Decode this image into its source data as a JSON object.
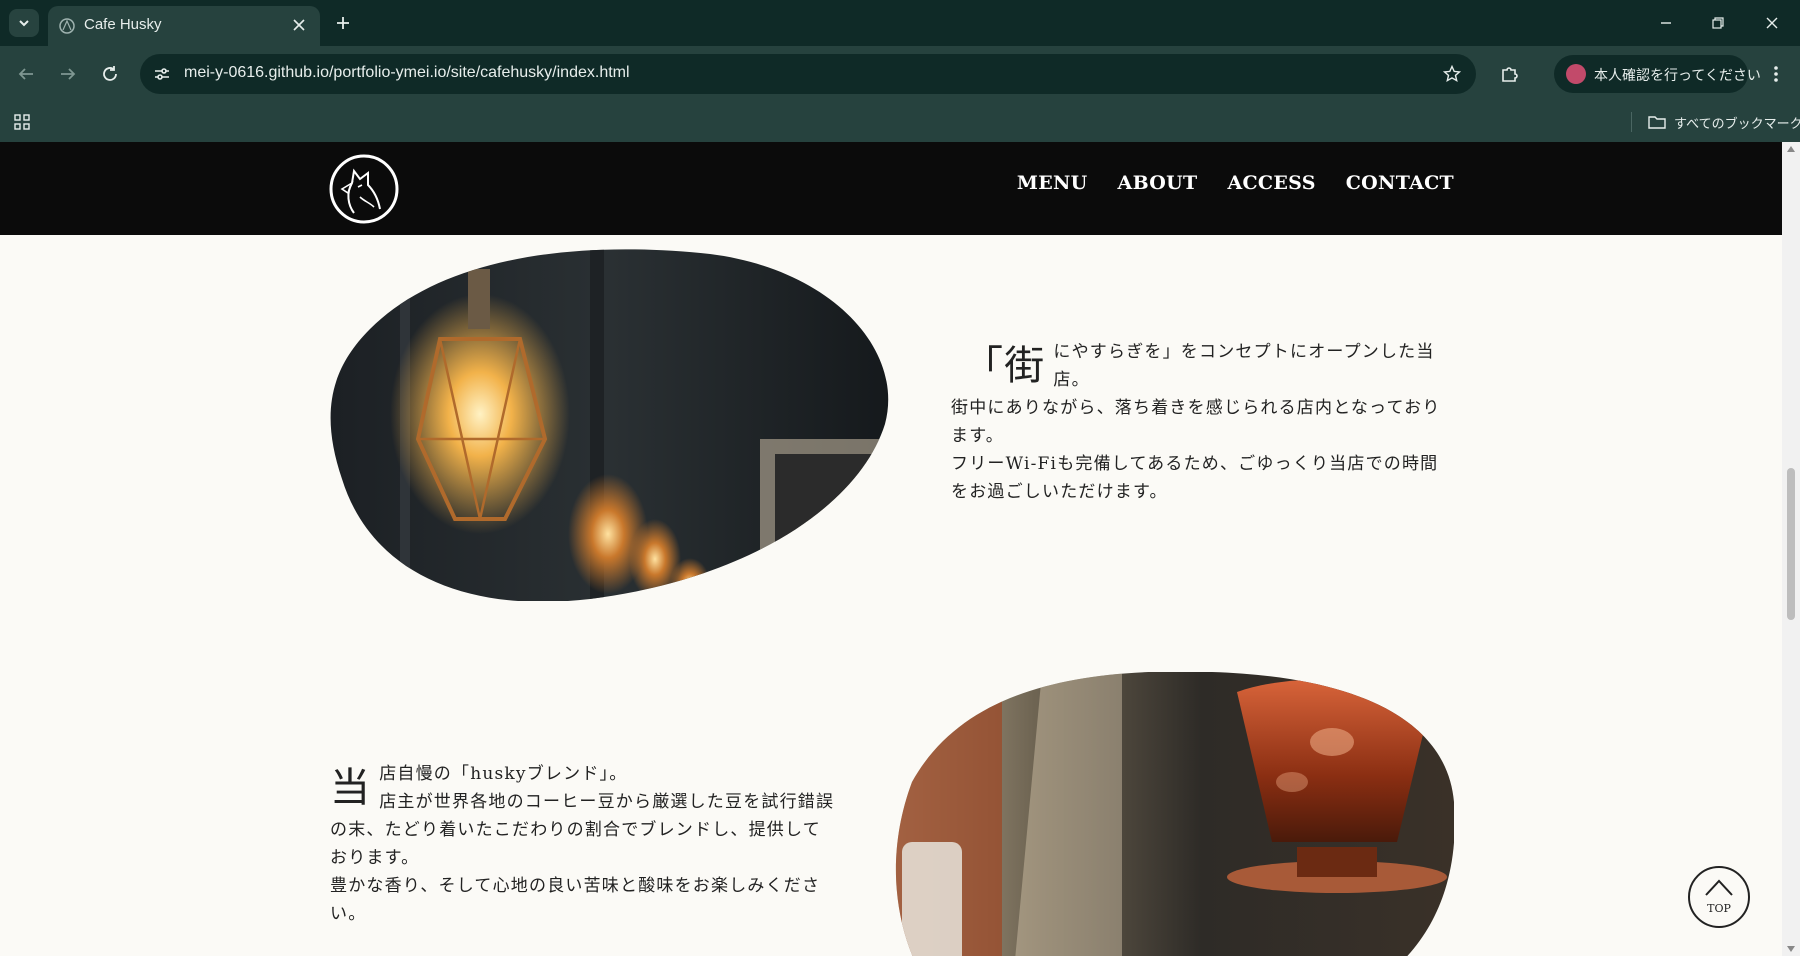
{
  "browser": {
    "tab_title": "Cafe Husky",
    "url": "mei-y-0616.github.io/portfolio-ymei.io/site/cafehusky/index.html",
    "profile_label": "本人確認を行ってください",
    "bookmarks_label": "すべてのブックマーク",
    "icons": {
      "tab_list": "chevron-down-icon",
      "new_tab": "plus-icon",
      "minimize": "minimize-icon",
      "restore": "restore-icon",
      "close": "close-icon",
      "back": "arrow-left-icon",
      "forward": "arrow-right-icon",
      "reload": "reload-icon",
      "site_info": "tune-icon",
      "bookmark_star": "star-icon",
      "extensions": "puzzle-icon",
      "menu": "kebab-icon",
      "apps": "apps-grid-icon",
      "folder": "folder-icon"
    }
  },
  "site": {
    "nav": [
      "MENU",
      "ABOUT",
      "ACCESS",
      "CONTACT"
    ],
    "about": {
      "dropcap": "「街",
      "lead": "にやすらぎを」をコンセプトにオープンした当店。",
      "line2": "街中にありながら、落ち着きを感じられる店内となっております。",
      "line3": "フリーWi-Fiも完備してあるため、ごゆっくり当店での時間をお過ごしいただけます。"
    },
    "blend": {
      "dropcap": "当",
      "lead": "店自慢の「huskyブレンド」。",
      "line2": "店主が世界各地のコーヒー豆から厳選した豆を試行錯誤の末、たどり着いたこだわりの割合でブレンドし、提供しております。",
      "line3": "豊かな香り、そして心地の良い苦味と酸味をお楽しみください。"
    },
    "top_button": "TOP"
  },
  "colors": {
    "chrome_dark": "#0f2a27",
    "chrome_mid": "#26423e",
    "site_header": "#0b0b0b",
    "page_bg": "#fbfaf6",
    "text": "#222222"
  }
}
